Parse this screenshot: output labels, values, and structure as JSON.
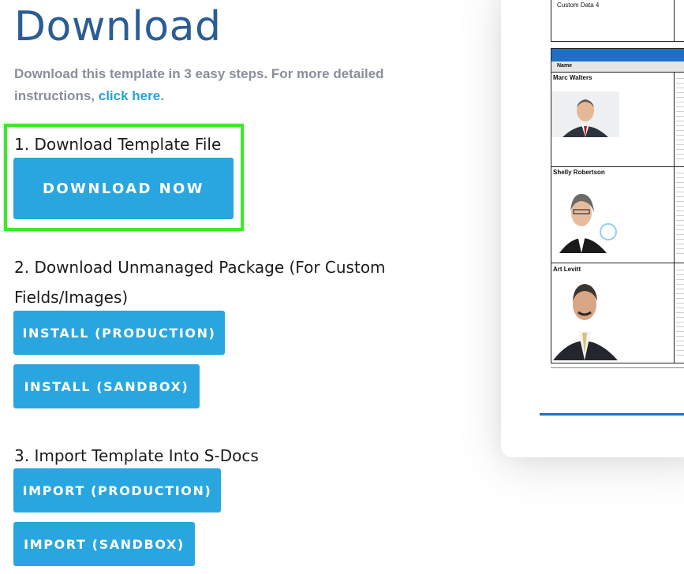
{
  "page": {
    "title": "Download",
    "intro_text": "Download this template in 3 easy steps. For more detailed instructions, ",
    "intro_link": "click here",
    "intro_end": "."
  },
  "steps": {
    "step1_label": "1. Download Template File",
    "download_now": "DOWNLOAD NOW",
    "step2_label_line1": "2. Download Unmanaged Package (For Custom",
    "step2_label_line2": "Fields/Images)",
    "install_production": "INSTALL (PRODUCTION)",
    "install_sandbox": "INSTALL (SANDBOX)",
    "step3_label": "3. Import Template Into S-Docs",
    "import_production": "IMPORT (PRODUCTION)",
    "import_sandbox": "IMPORT (SANDBOX)"
  },
  "preview": {
    "custom_data": "Custom Data 4",
    "column_name": "Name",
    "people": [
      "Marc Walters",
      "Shelly Robertson",
      "Art Levitt"
    ]
  },
  "colors": {
    "button": "#29a6df",
    "title": "#2a5d94",
    "highlight": "#3fe82c",
    "link": "#2aa2de"
  }
}
